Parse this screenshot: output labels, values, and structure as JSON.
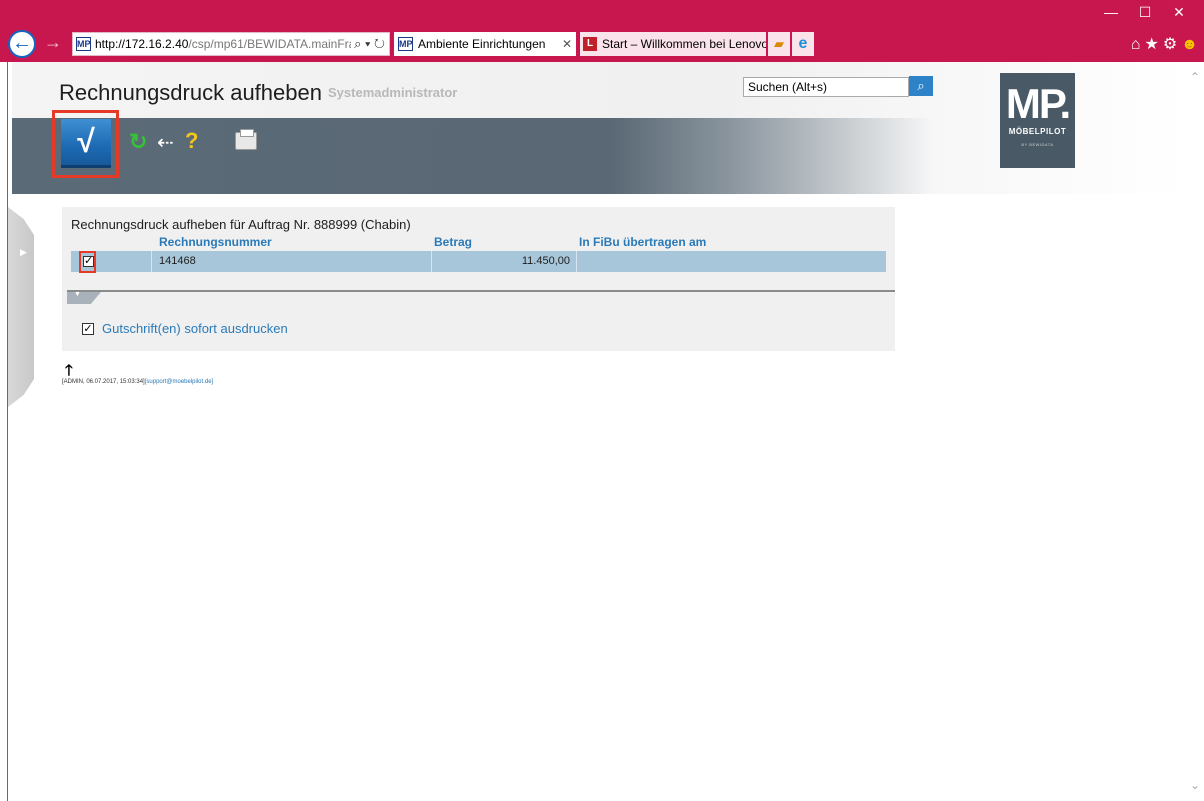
{
  "browser": {
    "url_host": "http://172.16.2.40",
    "url_path": "/csp/mp61/BEWIDATA.mainFra",
    "address_icons": "⌕ ▾ ↻",
    "favicon_text": "MP",
    "active_tab": "Ambiente Einrichtungen",
    "inactive_tab": "Start – Willkommen bei Lenovo",
    "inactive_tab_favicon": "L",
    "window_controls": [
      "—",
      "☐",
      "✕"
    ]
  },
  "header": {
    "title": "Rechnungsdruck aufheben",
    "subtitle": "Systemadministrator",
    "search_value": "Suchen (Alt+s)"
  },
  "logo": {
    "mark": "MP.",
    "text": "MÖBELPILOT",
    "sub": "BY BEWIDATA"
  },
  "toolbar": {
    "confirm_glyph": "√",
    "refresh_glyph": "↻",
    "back_glyph": "⇠",
    "help_glyph": "?"
  },
  "grid": {
    "caption": "Rechnungsdruck aufheben für Auftrag Nr. 888999 (Chabin)",
    "columns": [
      "Rechnungsnummer",
      "Betrag",
      "In FiBu übertragen am"
    ],
    "rows": [
      {
        "checked": "✓",
        "rechnungsnummer": "141468",
        "betrag": "11.450,00",
        "fibu": ""
      }
    ]
  },
  "options": {
    "gutschrift_checked": "✓",
    "gutschrift_label": "Gutschrift(en) sofort ausdrucken"
  },
  "footer": {
    "info": "[ADMIN, 06.07.2017, 15:03:34]",
    "email": "[support@moebelpilot.de]",
    "up_arrow": "🡑"
  },
  "icons": [
    "back-icon",
    "forward-icon",
    "search-icon",
    "refresh-icon",
    "close-icon",
    "home-icon",
    "star-icon",
    "gear-icon",
    "smiley-icon",
    "check-icon",
    "help-icon",
    "print-icon",
    "arrow-up-icon"
  ],
  "colors": {
    "titlebar": "#c8174f",
    "header_band": "#5b6a77",
    "accent_blue": "#2a7ab8",
    "confirm_button": "#1d6ab3",
    "highlight_red": "#e63a28",
    "row_selected": "#a8c6d9"
  }
}
